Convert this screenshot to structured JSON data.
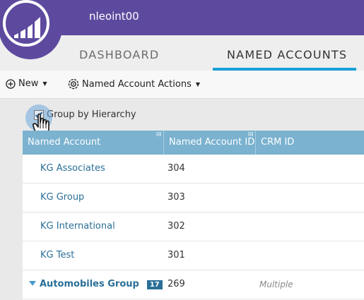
{
  "header": {
    "user_name": "nleoint00",
    "tabs": [
      {
        "label": "DASHBOARD",
        "active": false
      },
      {
        "label": "NAMED ACCOUNTS",
        "active": true
      }
    ],
    "accent_color": "#5d4a9f",
    "tab_underline_color": "#1aa0d8"
  },
  "toolbar": {
    "new_label": "New",
    "actions_label": "Named Account Actions"
  },
  "grouping": {
    "label": "Group by Hierarchy",
    "checked": true
  },
  "table": {
    "columns": [
      "Named Account",
      "Named Account ID",
      "CRM ID"
    ],
    "rows": [
      {
        "name": "KG Associates",
        "id": "304",
        "crm": ""
      },
      {
        "name": "KG Group",
        "id": "303",
        "crm": ""
      },
      {
        "name": "KG International",
        "id": "302",
        "crm": ""
      },
      {
        "name": "KG Test",
        "id": "301",
        "crm": ""
      }
    ],
    "group_row": {
      "name": "Automobiles Group",
      "count": "17",
      "id": "269",
      "crm": "Multiple"
    }
  }
}
